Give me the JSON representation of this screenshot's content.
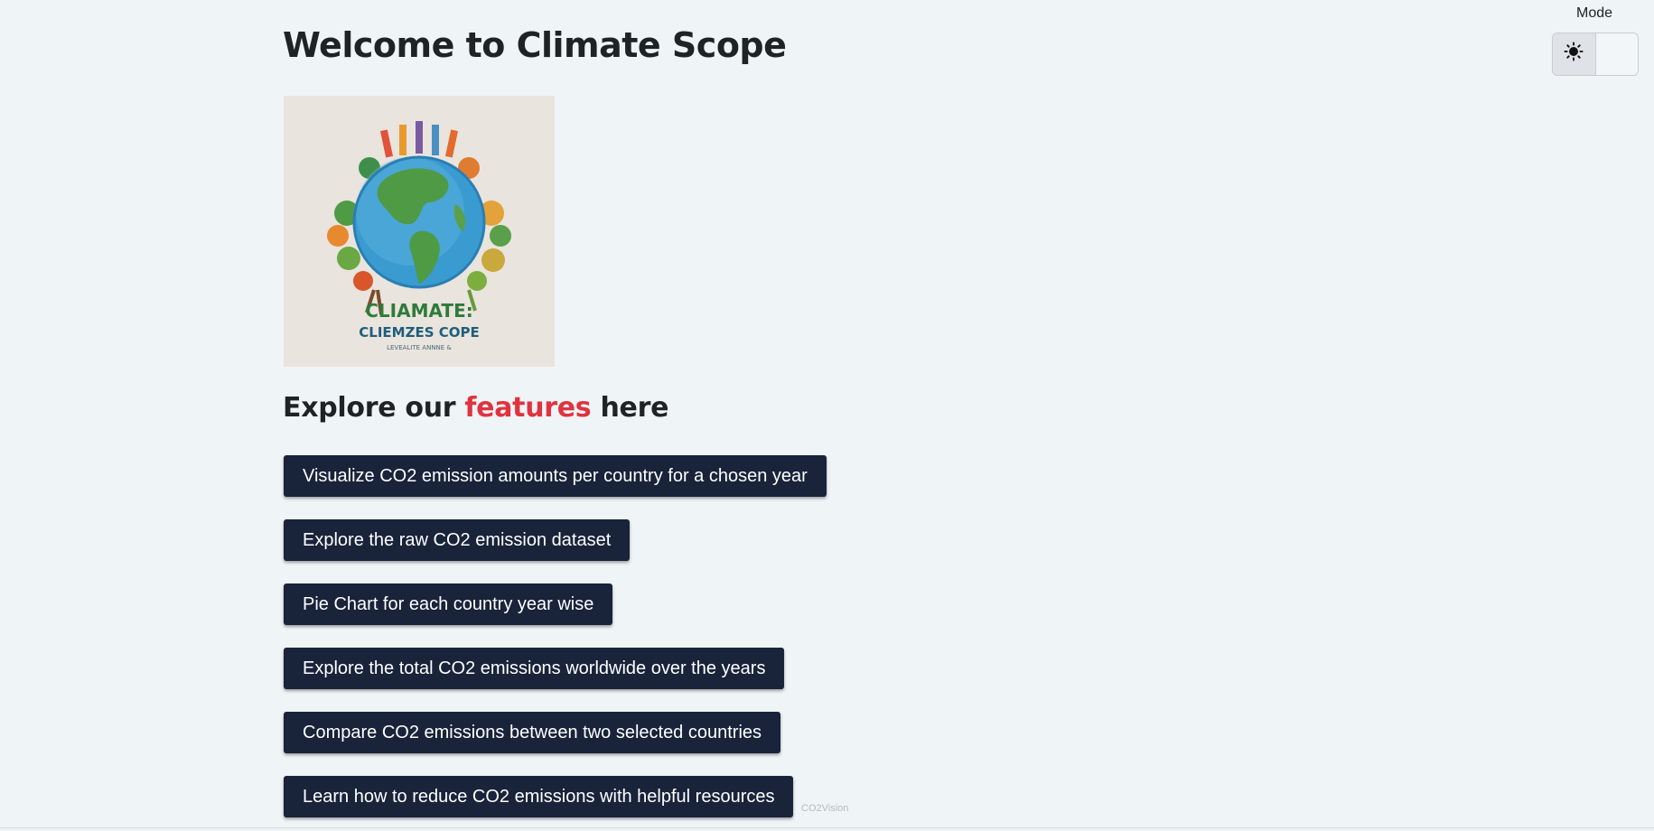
{
  "header": {
    "title": "Welcome to Climate Scope",
    "mode_label": "Mode",
    "mode_light_icon": "sun-icon",
    "mode_dark_icon": "moon-icon"
  },
  "logo": {
    "text_line1": "CLIAMATE:",
    "text_line2": "CLIEMZES COPE",
    "text_line3": "LEVEALITE ANNNE &",
    "colors": {
      "ocean": "#3a9bd0",
      "land": "#4f9a45",
      "background": "#e9e4dd"
    }
  },
  "features": {
    "heading_prefix": "Explore our ",
    "heading_highlight": "features",
    "heading_suffix": " here",
    "buttons": [
      {
        "label": "Visualize CO2 emission amounts per country for a chosen year"
      },
      {
        "label": "Explore the raw CO2 emission dataset"
      },
      {
        "label": "Pie Chart for each country year wise"
      },
      {
        "label": "Explore the total CO2 emissions worldwide over the years"
      },
      {
        "label": "Compare CO2 emissions between two selected countries"
      },
      {
        "label": "Learn how to reduce CO2 emissions with helpful resources"
      }
    ]
  },
  "footer": {
    "mark": "CO2Vision"
  },
  "colors": {
    "background": "#eff4f7",
    "button": "#19233a",
    "highlight": "#e1333f",
    "heading": "#1f2326"
  }
}
